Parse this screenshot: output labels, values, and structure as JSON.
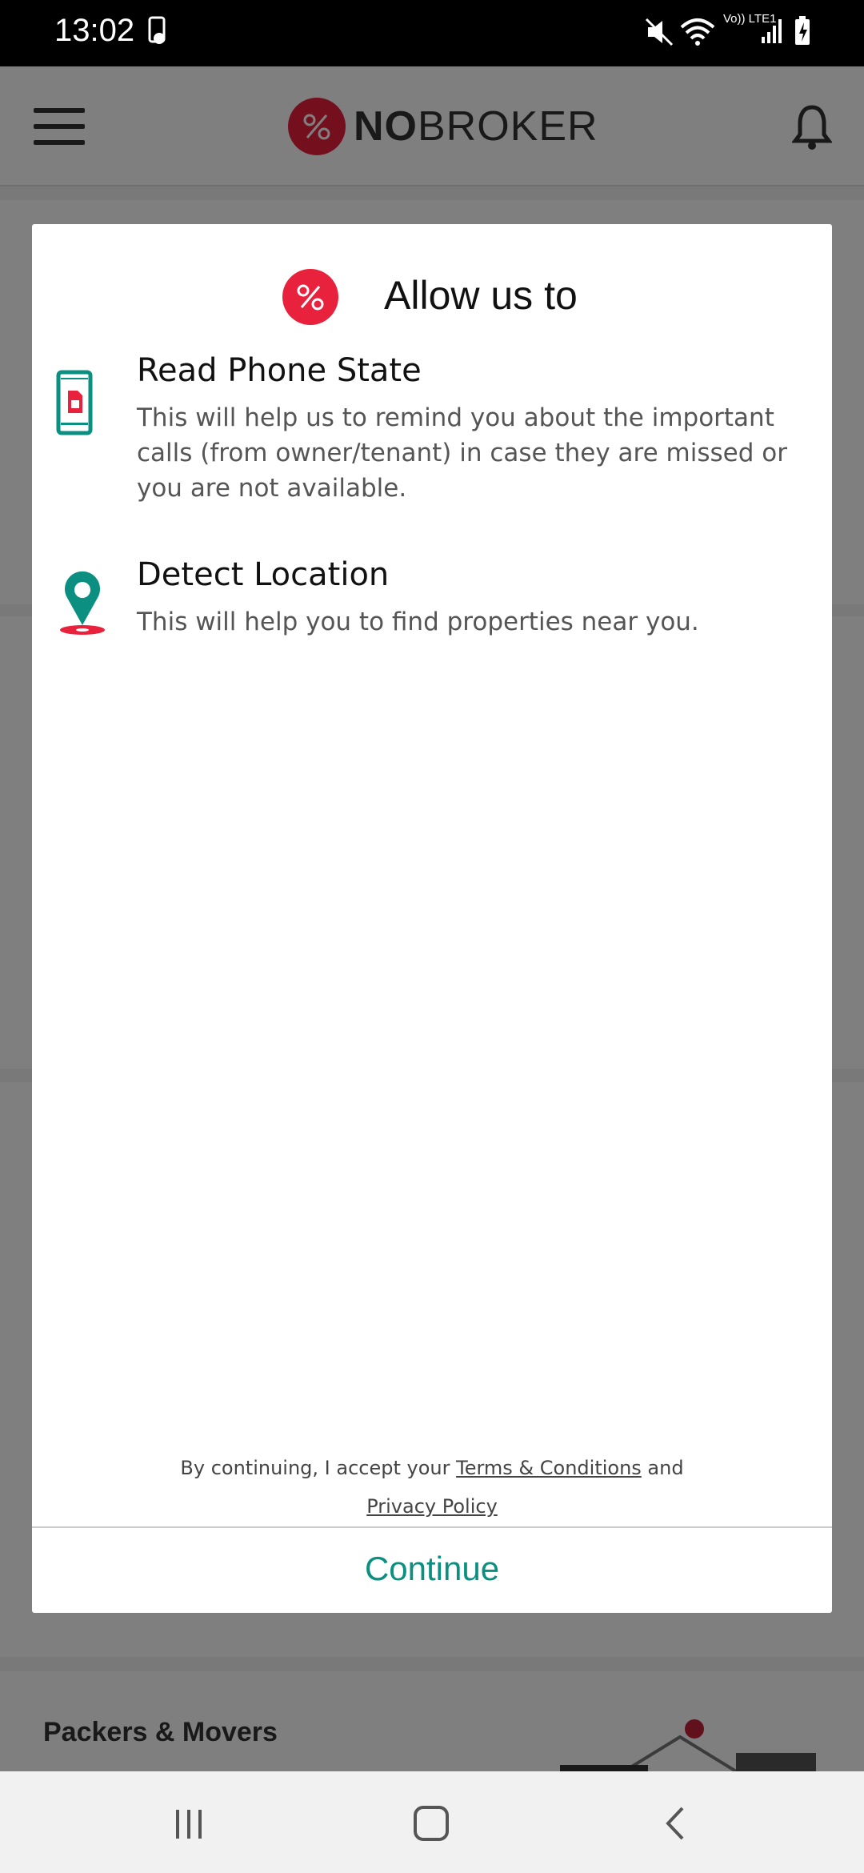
{
  "status_bar": {
    "time": "13:02",
    "icons": [
      "touch-icon",
      "mute-icon",
      "wifi-icon",
      "volte-icon",
      "signal-icon",
      "battery-charging-icon"
    ],
    "volte_label": "Vo)) LTE1"
  },
  "app_bar": {
    "logo_text_bold": "NO",
    "logo_text_rest": "BROKER",
    "menu_icon": "menu-icon",
    "notification_icon": "bell-icon"
  },
  "background": {
    "packers_label": "Packers & Movers"
  },
  "dialog": {
    "title": "Allow us to",
    "permissions": [
      {
        "icon": "phone-sim-icon",
        "title": "Read Phone State",
        "description": "This will help us to remind you about the important calls (from owner/tenant) in case they are missed or you are not available."
      },
      {
        "icon": "location-pin-icon",
        "title": "Detect Location",
        "description": "This will help you to find properties near you."
      }
    ],
    "consent_prefix": "By continuing, I accept your ",
    "terms_link": "Terms & Conditions",
    "consent_and": " and",
    "privacy_link": "Privacy Policy",
    "continue_label": "Continue"
  },
  "colors": {
    "brand_red": "#e8213c",
    "accent_teal": "#0b8f80"
  }
}
